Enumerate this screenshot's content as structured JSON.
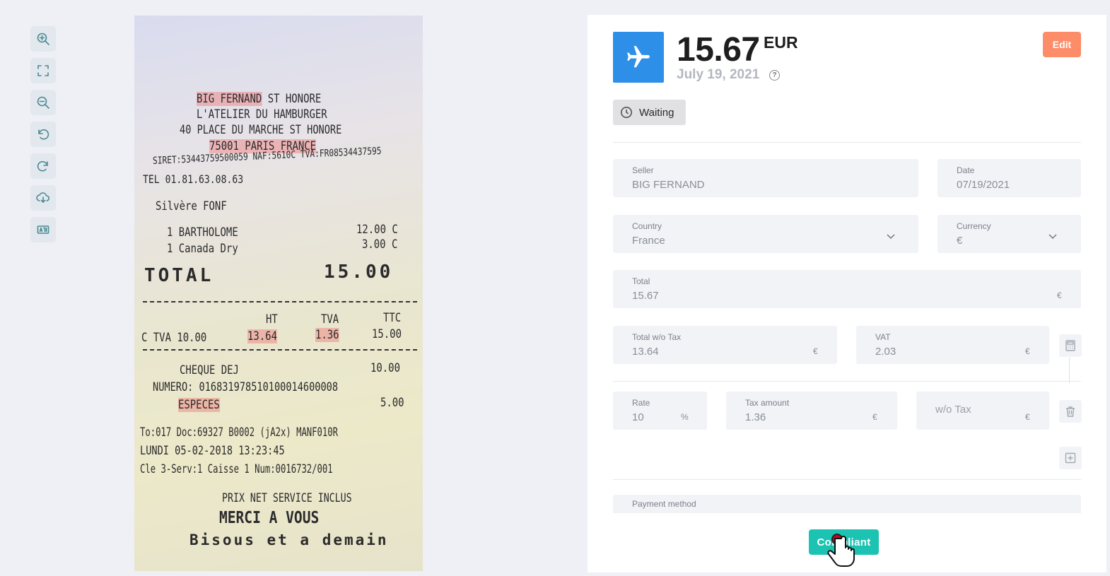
{
  "toolbar": {
    "tools": [
      "zoom-in-icon",
      "fullscreen-icon",
      "zoom-out-icon",
      "rotate-left-icon",
      "rotate-right-icon",
      "cloud-download-icon",
      "ocr-icon"
    ]
  },
  "receipt": {
    "line1": "BIG FERNAND ST HONORE",
    "line2": "L'ATELIER DU HAMBURGER",
    "line3": "40 PLACE DU MARCHE ST HONORE",
    "line4": "75001 PARIS FRANCE",
    "line5": "SIRET:53443759500059 NAF:5610C TVA:FR08534437595",
    "line6": "TEL 01.81.63.08.63",
    "server": "Silvère FONF",
    "item1_name": "1 BARTHOLOME",
    "item1_price": "12.00 C",
    "item2_name": "1 Canada Dry",
    "item2_price": "3.00 C",
    "total_label": "TOTAL",
    "total_value": "15.00",
    "tax_head_ht": "HT",
    "tax_head_tva": "TVA",
    "tax_head_ttc": "TTC",
    "tax_row_label": "C TVA 10.00",
    "tax_row_ht": "13.64",
    "tax_row_tva": "1.36",
    "tax_row_ttc": "15.00",
    "cheque_label": "CHEQUE DEJ",
    "cheque_value": "10.00",
    "numero": "NUMERO: 016831978510100014600008",
    "especes_label": "ESPECES",
    "especes_value": "5.00",
    "doc_line": "To:017 Doc:69327    B0002  (jA2x) MANF010R",
    "date_line": "LUNDI 05-02-2018 13:23:45",
    "caisse_line": "Cle 3-Serv:1  Caisse 1   Num:0016732/001",
    "footer1": "PRIX NET SERVICE INCLUS",
    "footer2": "MERCI A VOUS",
    "footer3": "Bisous et a demain"
  },
  "expense": {
    "amount": "15.67",
    "currency_code": "EUR",
    "date": "July 19, 2021",
    "help": "?",
    "edit_label": "Edit",
    "status": "Waiting",
    "category_icon": "airplane-icon"
  },
  "fields": {
    "seller": {
      "label": "Seller",
      "value": "BIG FERNAND"
    },
    "date": {
      "label": "Date",
      "value": "07/19/2021"
    },
    "country": {
      "label": "Country",
      "value": "France"
    },
    "currency": {
      "label": "Currency",
      "value": "€"
    },
    "total": {
      "label": "Total",
      "value": "15.67",
      "unit": "€"
    },
    "total_wo_tax": {
      "label": "Total w/o Tax",
      "value": "13.64",
      "unit": "€"
    },
    "vat": {
      "label": "VAT",
      "value": "2.03",
      "unit": "€"
    },
    "rate": {
      "label": "Rate",
      "value": "10",
      "unit": "%"
    },
    "tax_amount": {
      "label": "Tax amount",
      "value": "1.36",
      "unit": "€"
    },
    "wo_tax": {
      "placeholder": "w/o Tax",
      "unit": "€"
    },
    "payment_method": {
      "label": "Payment method"
    }
  },
  "actions": {
    "compliant_label": "Compliant"
  },
  "colors": {
    "accent_blue": "#2d8fe8",
    "edit_orange": "#fd8c68",
    "compliant_teal": "#1cc3b2"
  }
}
